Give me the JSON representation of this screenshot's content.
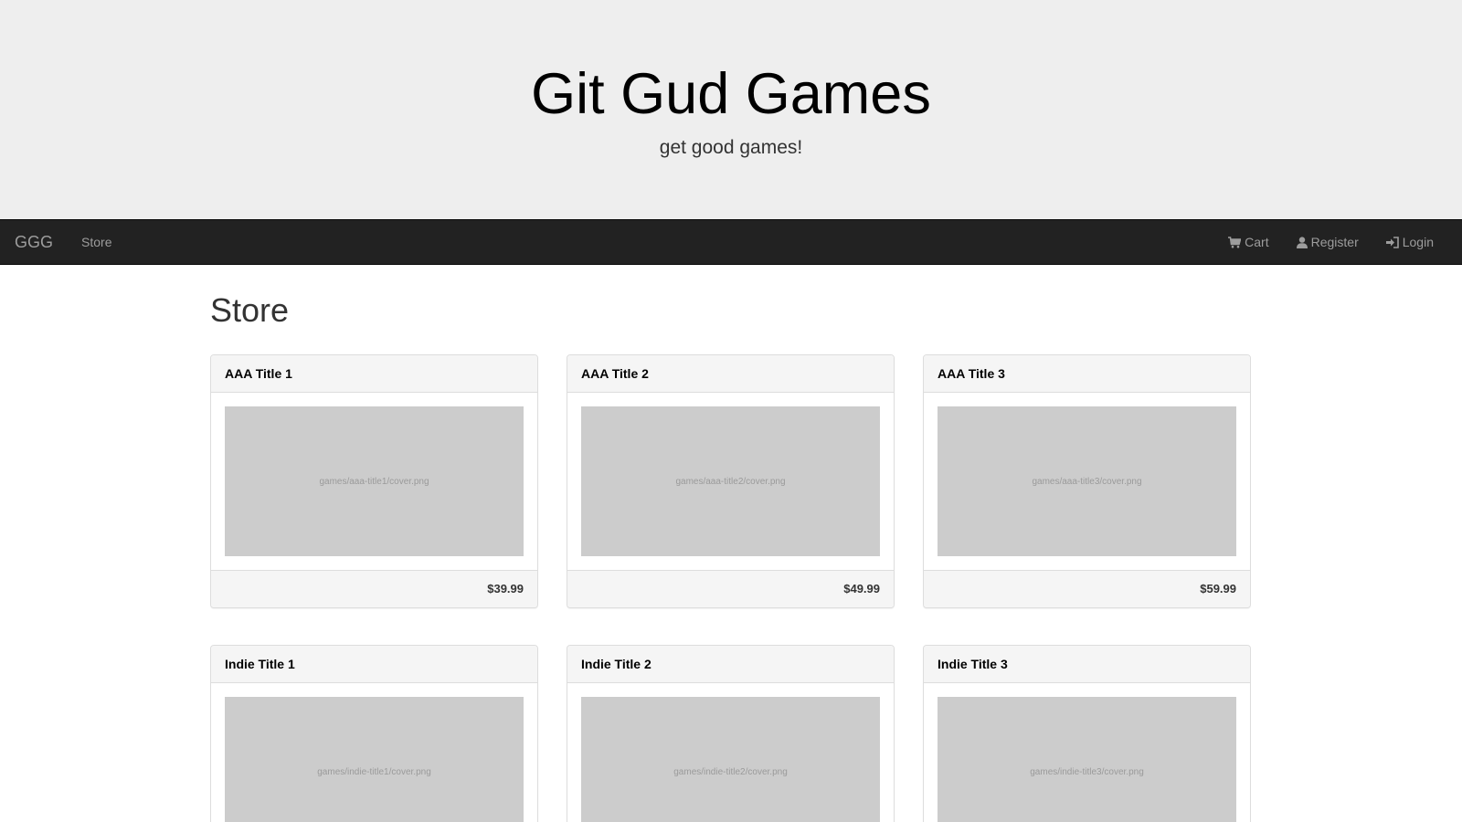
{
  "header": {
    "title": "Git Gud Games",
    "tagline": "get good games!"
  },
  "navbar": {
    "brand": "GGG",
    "store": "Store",
    "cart": "Cart",
    "register": "Register",
    "login": "Login",
    "icons": [
      "cart-icon",
      "user-icon",
      "login-icon"
    ]
  },
  "main": {
    "title": "Store",
    "games": [
      {
        "title": "AAA Title 1",
        "cover": "games/aaa-title1/cover.png",
        "price": "$39.99"
      },
      {
        "title": "AAA Title 2",
        "cover": "games/aaa-title2/cover.png",
        "price": "$49.99"
      },
      {
        "title": "AAA Title 3",
        "cover": "games/aaa-title3/cover.png",
        "price": "$59.99"
      },
      {
        "title": "Indie Title 1",
        "cover": "games/indie-title1/cover.png"
      },
      {
        "title": "Indie Title 2",
        "cover": "games/indie-title2/cover.png"
      },
      {
        "title": "Indie Title 3",
        "cover": "games/indie-title3/cover.png"
      }
    ]
  }
}
